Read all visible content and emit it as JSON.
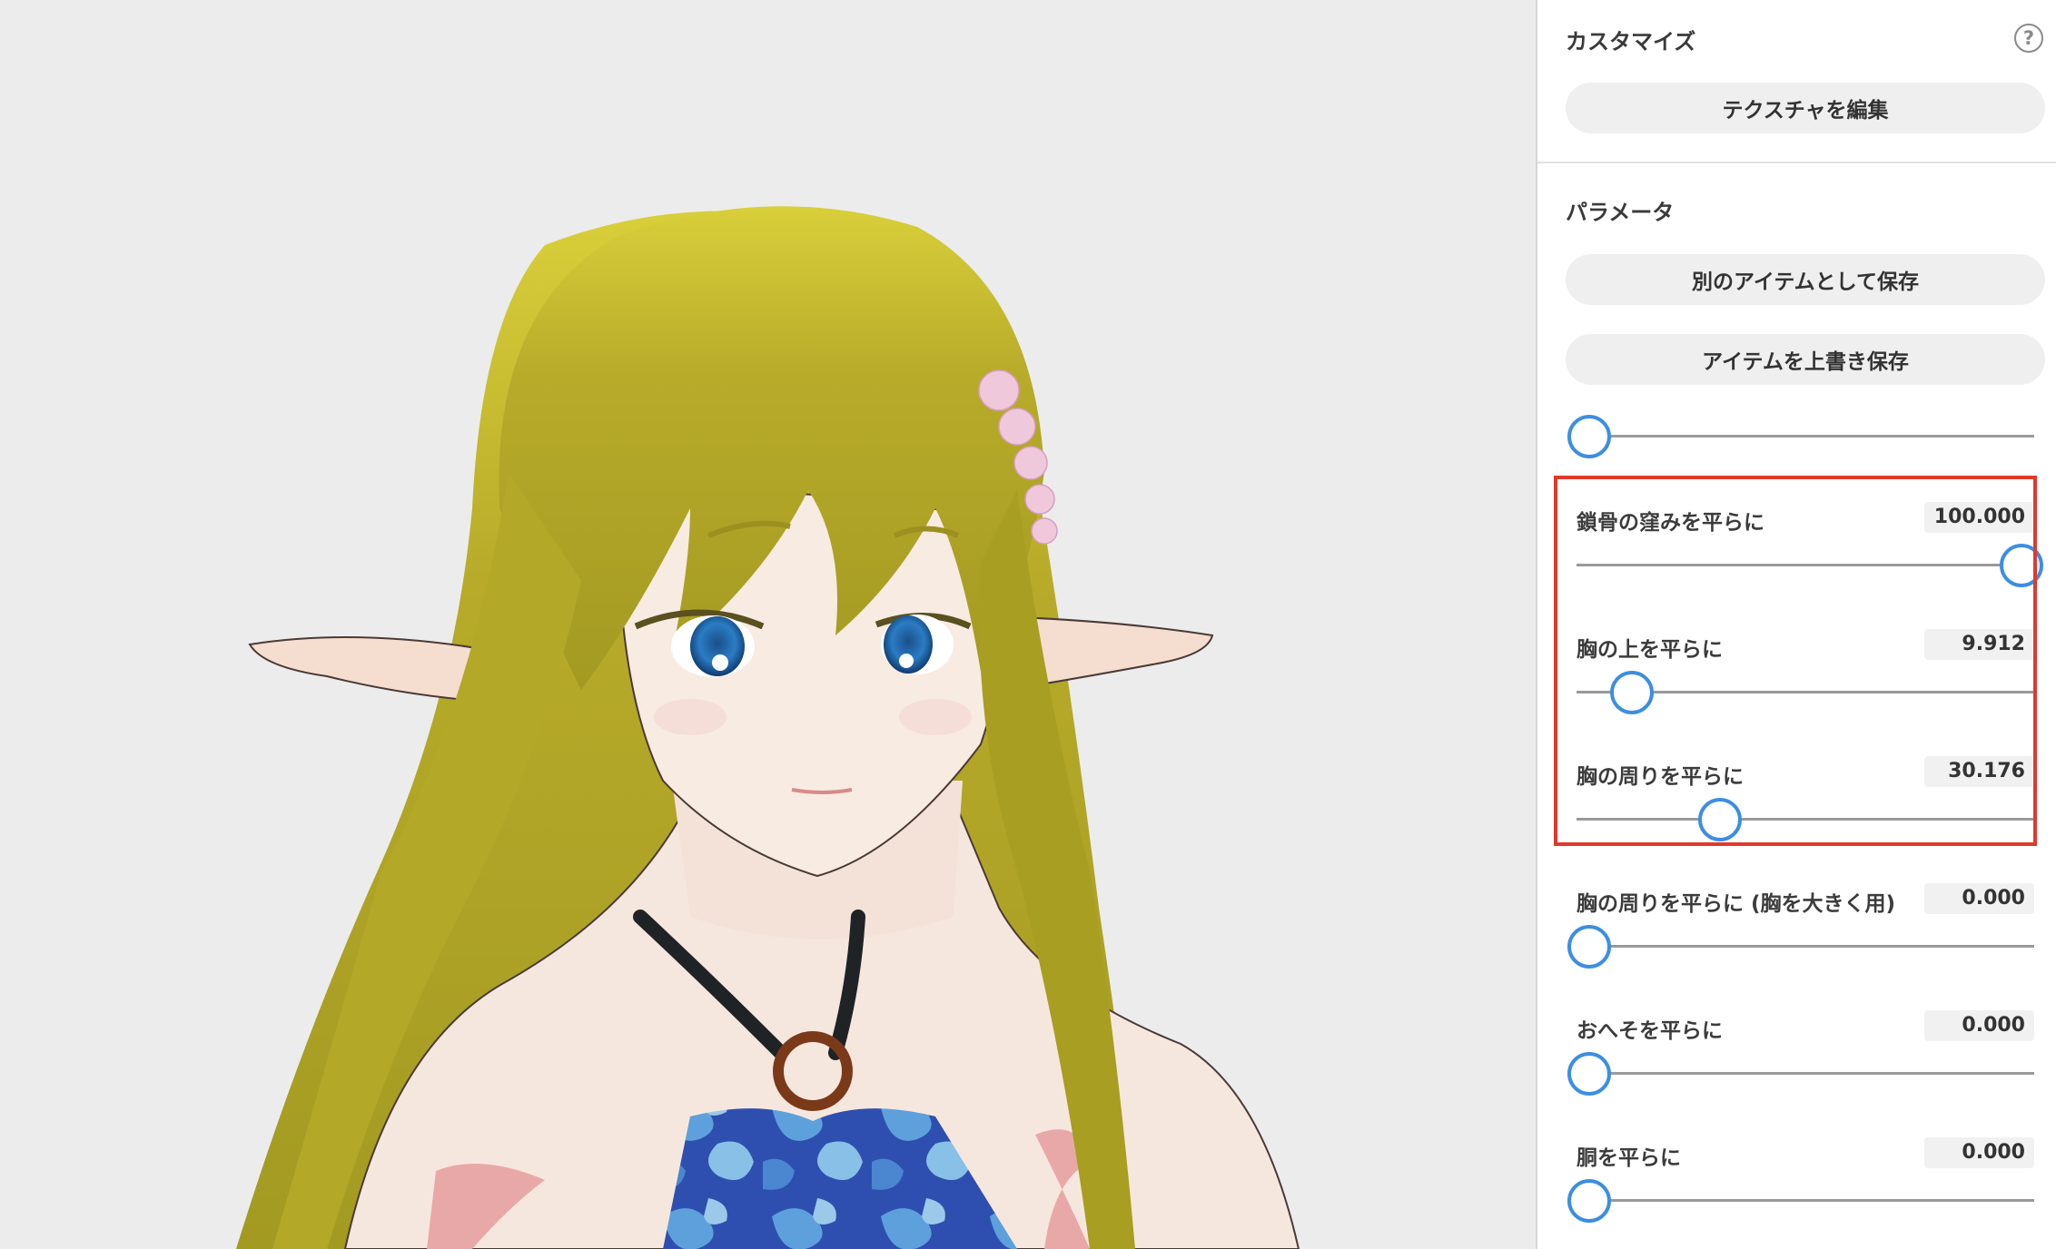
{
  "customize": {
    "title": "カスタマイズ",
    "help_icon": "question-circle-icon",
    "edit_texture_label": "テクスチャを編集"
  },
  "parameters": {
    "title": "パラメータ",
    "save_as_new_label": "別のアイテムとして保存",
    "overwrite_label": "アイテムを上書き保存",
    "top_slider_value": 0,
    "items": [
      {
        "label": "鎖骨の窪みを平らに",
        "value": "100.000",
        "fraction": 1.0
      },
      {
        "label": "胸の上を平らに",
        "value": "9.912",
        "fraction": 0.09912
      },
      {
        "label": "胸の周りを平らに",
        "value": "30.176",
        "fraction": 0.30176
      },
      {
        "label": "胸の周りを平らに (胸を大きく用)",
        "value": "0.000",
        "fraction": 0.0
      },
      {
        "label": "おへそを平らに",
        "value": "0.000",
        "fraction": 0.0
      },
      {
        "label": "胴を平らに",
        "value": "0.000",
        "fraction": 0.0
      }
    ]
  },
  "highlight_color": "#e0392b",
  "accent_color": "#3d8ee0"
}
